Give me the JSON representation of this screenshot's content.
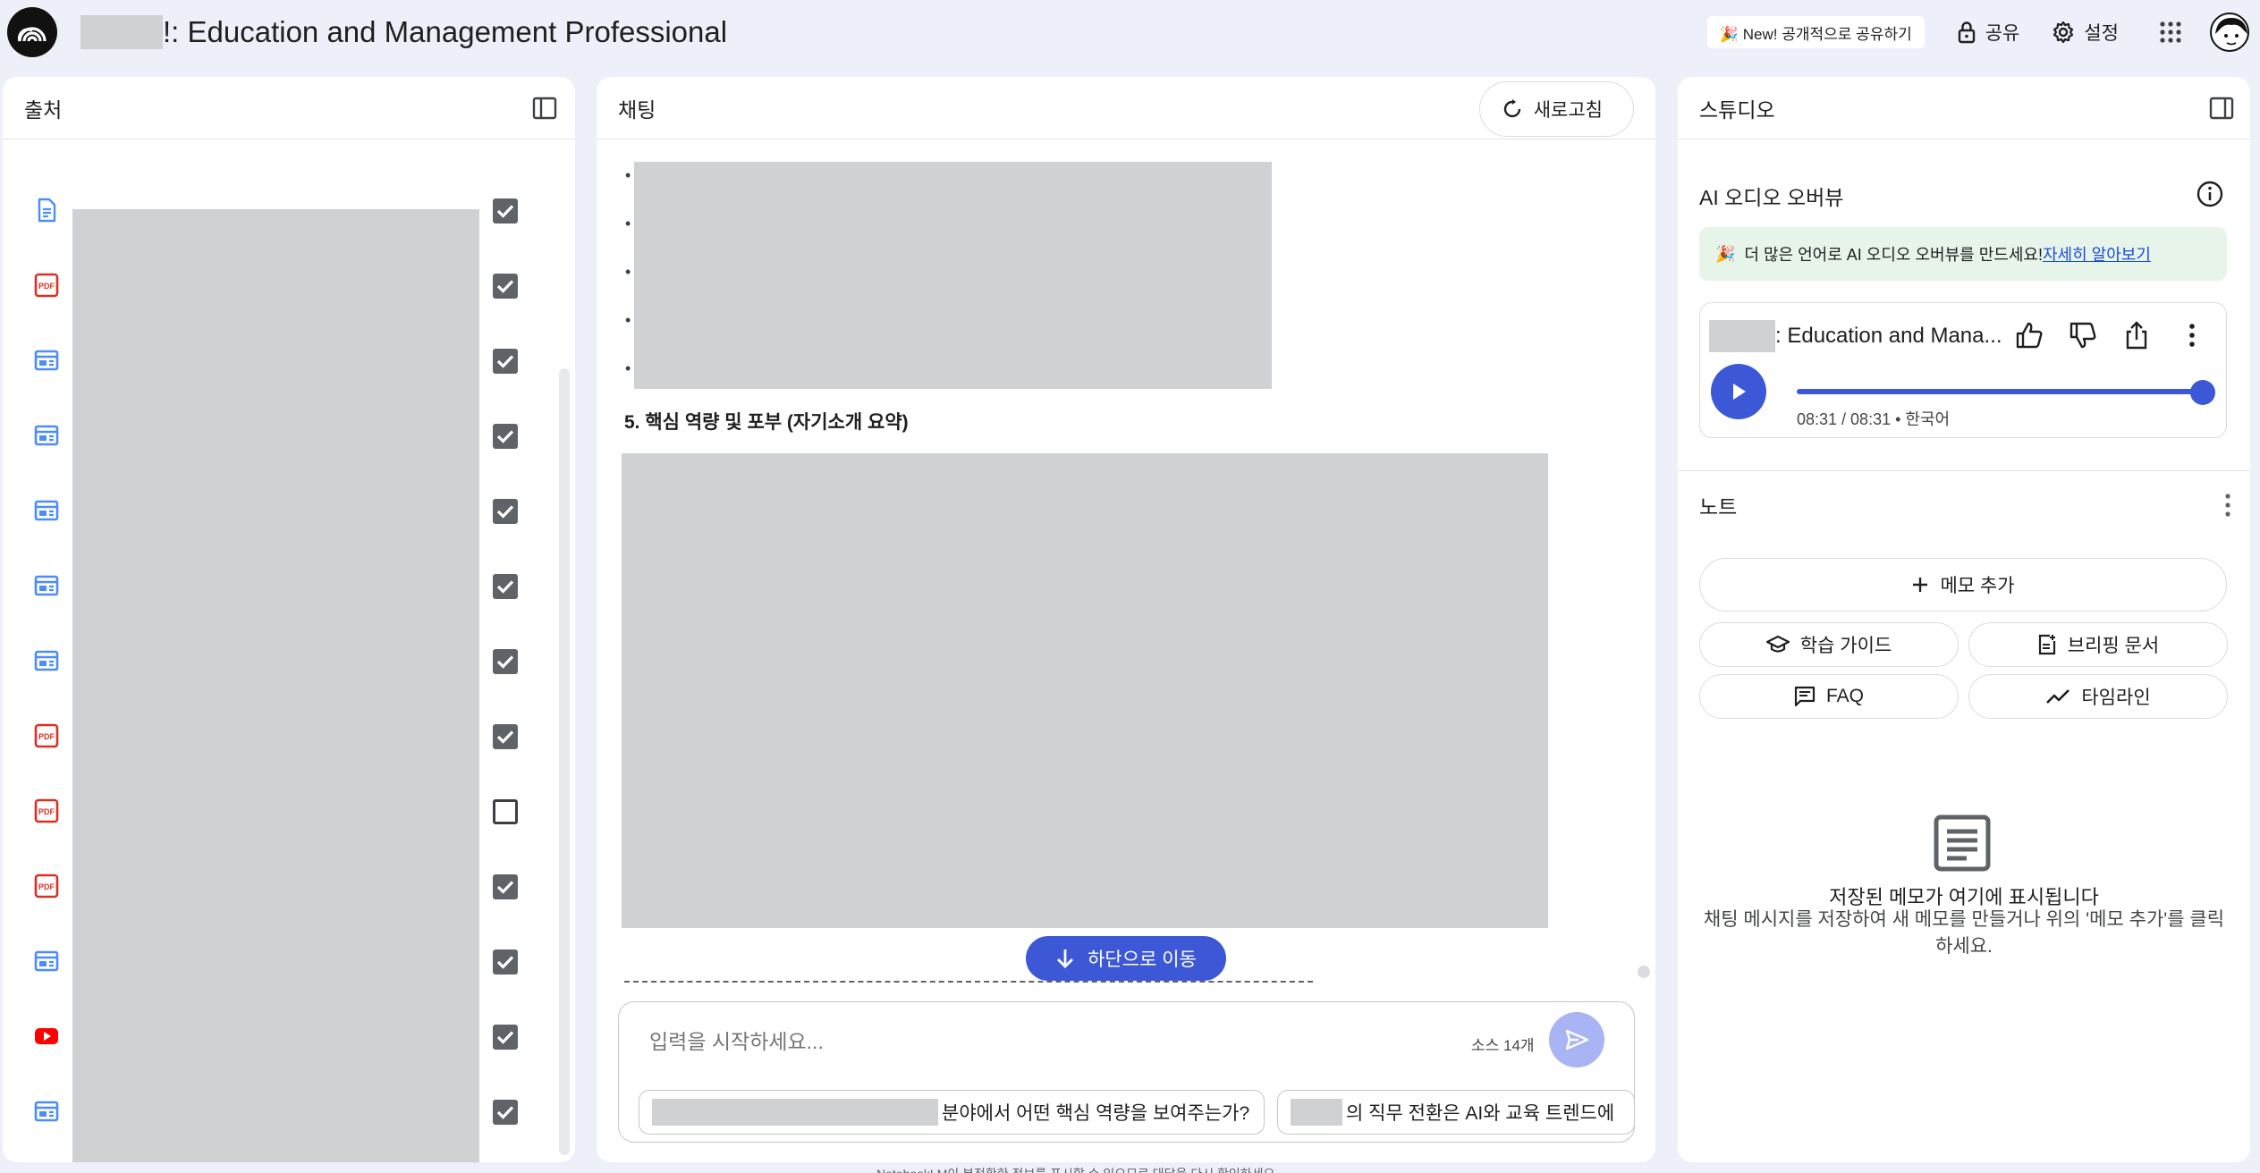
{
  "header": {
    "title_suffix": "!: Education and Management Professional",
    "new_share_label": "🎉 New! 공개적으로 공유하기",
    "share_label": "공유",
    "settings_label": "설정"
  },
  "sources": {
    "title": "출처",
    "items": [
      {
        "icon": "document-icon",
        "checked": true
      },
      {
        "icon": "pdf-icon",
        "checked": true
      },
      {
        "icon": "web-icon",
        "checked": true
      },
      {
        "icon": "web-icon",
        "checked": true
      },
      {
        "icon": "web-icon",
        "checked": true
      },
      {
        "icon": "web-icon",
        "checked": true
      },
      {
        "icon": "web-icon",
        "checked": true
      },
      {
        "icon": "pdf-icon",
        "checked": true
      },
      {
        "icon": "pdf-icon",
        "checked": false
      },
      {
        "icon": "pdf-icon",
        "checked": true
      },
      {
        "icon": "web-icon",
        "checked": true
      },
      {
        "icon": "youtube-icon",
        "checked": true
      },
      {
        "icon": "web-icon",
        "checked": true
      }
    ]
  },
  "chat": {
    "title": "채팅",
    "refresh_label": "새로고침",
    "bullets": [
      "•",
      "•",
      "•",
      "•",
      "•"
    ],
    "section_heading": "5. 핵심 역량 및 포부 (자기소개 요약)",
    "scroll_bottom_label": "하단으로 이동",
    "input_placeholder": "입력을 시작하세요...",
    "source_count": "소스 14개",
    "suggestions": [
      {
        "text": "분야에서 어떤 핵심 역량을 보여주는가?"
      },
      {
        "text": "의 직무 전환은 AI와 교육 트렌드에"
      }
    ]
  },
  "studio": {
    "title": "스튜디오",
    "audio_overview_title": "AI 오디오 오버뷰",
    "banner_text": "더 많은 언어로 AI 오디오 오버뷰를 만드세요!",
    "banner_link": "자세히 알아보기",
    "audio_card": {
      "title": ": Education and Mana...",
      "time": "08:31 / 08:31 • 한국어",
      "progress": 1.0
    },
    "notes_title": "노트",
    "add_note_label": "메모 추가",
    "study_guide_label": "학습 가이드",
    "briefing_label": "브리핑 문서",
    "faq_label": "FAQ",
    "timeline_label": "타임라인",
    "empty_title": "저장된 메모가 여기에 표시됩니다",
    "empty_desc": "채팅 메시지를 저장하여 새 메모를 만들거나 위의 '메모 추가'를 클릭하세요."
  },
  "colors": {
    "accent": "#3d58d6",
    "background": "#eef0f9",
    "redaction": "#cfd1d3",
    "pdf_red": "#d93025",
    "web_blue": "#4c8df6",
    "youtube_red": "#ff0000"
  }
}
